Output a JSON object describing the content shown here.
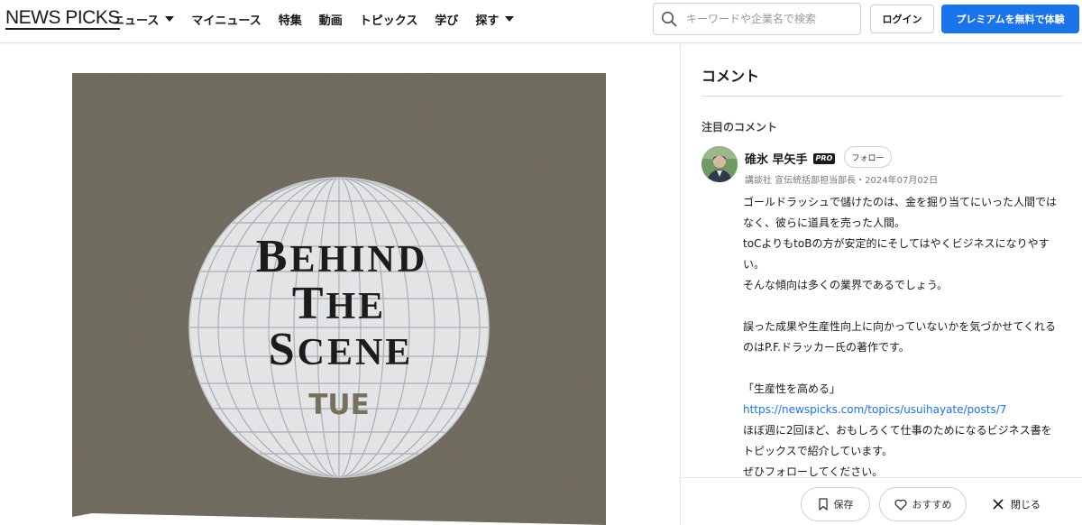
{
  "header": {
    "logo": "NEWS PICKS",
    "nav": [
      {
        "label": "ニュース",
        "dropdown": true
      },
      {
        "label": "マイニュース",
        "dropdown": false
      },
      {
        "label": "特集",
        "dropdown": false
      },
      {
        "label": "動画",
        "dropdown": false
      },
      {
        "label": "トピックス",
        "dropdown": false
      },
      {
        "label": "学び",
        "dropdown": false
      },
      {
        "label": "探す",
        "dropdown": true
      }
    ],
    "search_placeholder": "キーワードや企業名で検索",
    "login_label": "ログイン",
    "premium_label": "プレミアムを無料で体験",
    "accent_color": "#1a73e8"
  },
  "media": {
    "lines": [
      "BEHIND",
      "THE",
      "SCENE"
    ],
    "day": "TUE",
    "background_color": "#7a7567",
    "globe_color": "#e3e4e6"
  },
  "comments": {
    "title": "コメント",
    "featured_label": "注目のコメント",
    "author": {
      "name": "碓氷 早矢手",
      "badge": "PRO",
      "follow_label": "フォロー",
      "meta": "講談社 宣伝統括部担当部長・2024年07月02日"
    },
    "body": [
      "ゴールドラッシュで儲けたのは、金を掘り当てにいった人間ではなく、彼らに道具を売った人間。",
      "toCよりもtoBの方が安定的にそしてはやくビジネスになりやすい。",
      "そんな傾向は多くの業界であるでしょう。",
      "",
      "誤った成果や生産性向上に向かっていないかを気づかせてくれるのはP.F.ドラッカー氏の著作です。",
      "",
      "「生産性を高める」",
      "https://newspicks.com/topics/usuihayate/posts/7",
      "ほぼ週に2回ほど、おもしろくて仕事のためになるビジネス書をトピックスで紹介しています。",
      "ぜひフォローしてください。"
    ]
  },
  "actions": {
    "save_label": "保存",
    "recommend_label": "おすすめ",
    "close_label": "閉じる"
  }
}
